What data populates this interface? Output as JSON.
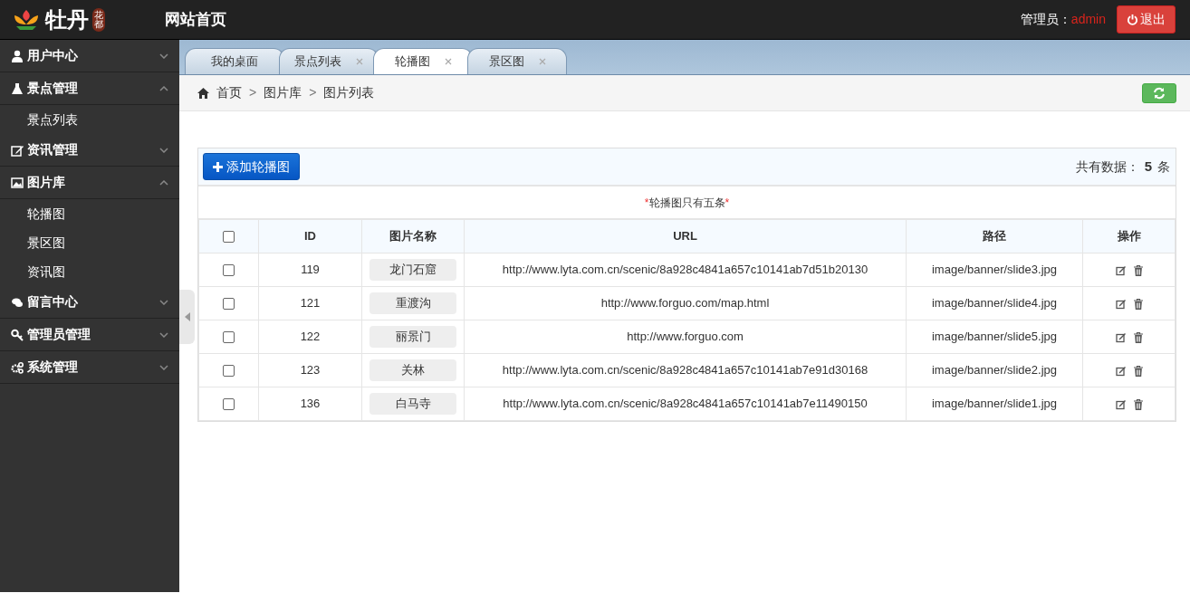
{
  "header": {
    "logo_text": "牡丹",
    "logo_sub": "花都",
    "title": "网站首页",
    "admin_label": "管理员：",
    "admin_name": "admin",
    "logout": "退出"
  },
  "sidebar": {
    "groups": [
      {
        "label": "用户中心",
        "expanded": false
      },
      {
        "label": "景点管理",
        "expanded": true,
        "children": [
          {
            "label": "景点列表"
          }
        ]
      },
      {
        "label": "资讯管理",
        "expanded": false
      },
      {
        "label": "图片库",
        "expanded": true,
        "children": [
          {
            "label": "轮播图"
          },
          {
            "label": "景区图"
          },
          {
            "label": "资讯图"
          }
        ]
      },
      {
        "label": "留言中心",
        "expanded": false
      },
      {
        "label": "管理员管理",
        "expanded": false
      },
      {
        "label": "系统管理",
        "expanded": false
      }
    ]
  },
  "tabs": [
    {
      "label": "我的桌面",
      "selected": false,
      "closable": false
    },
    {
      "label": "景点列表",
      "selected": false,
      "closable": true
    },
    {
      "label": "轮播图",
      "selected": true,
      "closable": true
    },
    {
      "label": "景区图",
      "selected": false,
      "closable": true
    }
  ],
  "breadcrumb": [
    "首页",
    "图片库",
    "图片列表"
  ],
  "breadcrumb_separators": [
    ">",
    ">"
  ],
  "toolbar": {
    "add_button": "添加轮播图",
    "count_label": "共有数据：",
    "count": "5",
    "count_unit": "条"
  },
  "notice": {
    "mark_before": "*",
    "text": "轮播图只有五条",
    "mark_after": "*"
  },
  "table": {
    "columns": [
      "ID",
      "图片名称",
      "URL",
      "路径",
      "操作"
    ],
    "header_checked": false,
    "rows": [
      {
        "checked": false,
        "id": "119",
        "name": "龙门石窟",
        "url": "http://www.lyta.com.cn/scenic/8a928c4841a657c10141ab7d51b20130",
        "path": "image/banner/slide3.jpg"
      },
      {
        "checked": false,
        "id": "121",
        "name": "重渡沟",
        "url": "http://www.forguo.com/map.html",
        "path": "image/banner/slide4.jpg"
      },
      {
        "checked": false,
        "id": "122",
        "name": "丽景门",
        "url": "http://www.forguo.com",
        "path": "image/banner/slide5.jpg"
      },
      {
        "checked": false,
        "id": "123",
        "name": "关林",
        "url": "http://www.lyta.com.cn/scenic/8a928c4841a657c10141ab7e91d30168",
        "path": "image/banner/slide2.jpg"
      },
      {
        "checked": false,
        "id": "136",
        "name": "白马寺",
        "url": "http://www.lyta.com.cn/scenic/8a928c4841a657c10141ab7e11490150",
        "path": "image/banner/slide1.jpg"
      }
    ]
  }
}
